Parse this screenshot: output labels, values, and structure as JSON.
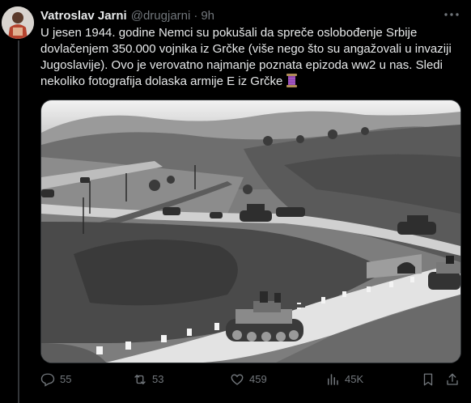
{
  "tweet": {
    "author_name": "Vatroslav Jarni",
    "author_handle": "@drugjarni",
    "separator": "·",
    "time": "9h",
    "text": "U jesen 1944. godine Nemci su pokušali da spreče oslobođenje Srbije dovlačenjem 350.000 vojnika iz Grčke (više nego što su angažovali u invaziji Jugoslavije). Ovo je verovatno najmanje poznata epizoda ww2 u nas. Sledi nekoliko fotografija dolaska armije E iz Grčke",
    "emoji_icon": "thread-spool-icon",
    "media_description_icon": "photo-icon"
  },
  "actions": {
    "replies": "55",
    "retweets": "53",
    "likes": "459",
    "views": "45K"
  },
  "icons": {
    "reply": "reply-icon",
    "retweet": "retweet-icon",
    "like": "heart-icon",
    "views": "views-icon",
    "bookmark": "bookmark-icon",
    "share": "share-icon",
    "more": "more-icon"
  },
  "colors": {
    "background": "#000000",
    "text": "#e7e9ea",
    "muted": "#71767b",
    "thread_line": "#333639",
    "emoji_purple": "#8e44ad"
  }
}
